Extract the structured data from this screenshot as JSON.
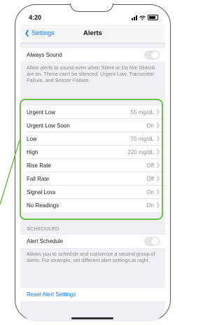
{
  "status_bar": {
    "time": "4:20"
  },
  "nav": {
    "back_label": "Settings",
    "title": "Alerts"
  },
  "always_sound": {
    "label": "Always Sound",
    "on": false,
    "note": "Allow alerts to sound even when Silent or Do Not Disturb are on. These can't be silenced: Urgent Low, Transmitter Failure, and Sensor Failure."
  },
  "alerts": [
    {
      "label": "Urgent Low",
      "value": "55 mg/dL"
    },
    {
      "label": "Urgent Low Soon",
      "value": "On"
    },
    {
      "label": "Low",
      "value": "70 mg/dL"
    },
    {
      "label": "High",
      "value": "220 mg/dL"
    },
    {
      "label": "Rise Rate",
      "value": "Off"
    },
    {
      "label": "Fall Rate",
      "value": "Off"
    },
    {
      "label": "Signal Loss",
      "value": "On"
    },
    {
      "label": "No Readings",
      "value": "On"
    }
  ],
  "scheduled": {
    "header": "SCHEDULED",
    "label": "Alert Schedule",
    "on": false,
    "note": "Allows you to schedule and customize a second group of alerts. For example, set different alert settings at night."
  },
  "reset_label": "Reset Alert Settings",
  "colors": {
    "accent": "#0a7aff",
    "highlight": "#6cc04a",
    "toggle_off": "#e6e6ea"
  }
}
